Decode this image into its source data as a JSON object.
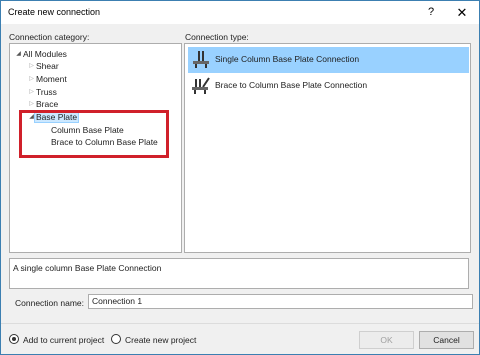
{
  "window": {
    "title": "Create new connection",
    "help_glyph": "?",
    "close_glyph": "✕"
  },
  "category": {
    "label": "Connection category:",
    "root": "All Modules",
    "items": [
      "Shear",
      "Moment",
      "Truss",
      "Brace",
      "Base Plate"
    ],
    "selected": "Base Plate",
    "children": [
      "Column Base Plate",
      "Brace to Column Base Plate"
    ]
  },
  "connection_type": {
    "label": "Connection type:",
    "items": [
      {
        "label": "Single Column Base Plate Connection",
        "icon": "single-base-plate-icon",
        "selected": true
      },
      {
        "label": "Brace to Column Base Plate Connection",
        "icon": "brace-base-plate-icon",
        "selected": false
      }
    ]
  },
  "description": "A single column Base Plate Connection",
  "connection_name": {
    "label": "Connection name:",
    "value": "Connection 1"
  },
  "target": {
    "options": [
      "Add to current project",
      "Create new project"
    ],
    "selected": "Add to current project"
  },
  "buttons": {
    "ok": "OK",
    "cancel": "Cancel"
  },
  "colors": {
    "selection": "#99d1ff",
    "highlight_box": "#d0202a",
    "window_border": "#3c7fb1"
  }
}
